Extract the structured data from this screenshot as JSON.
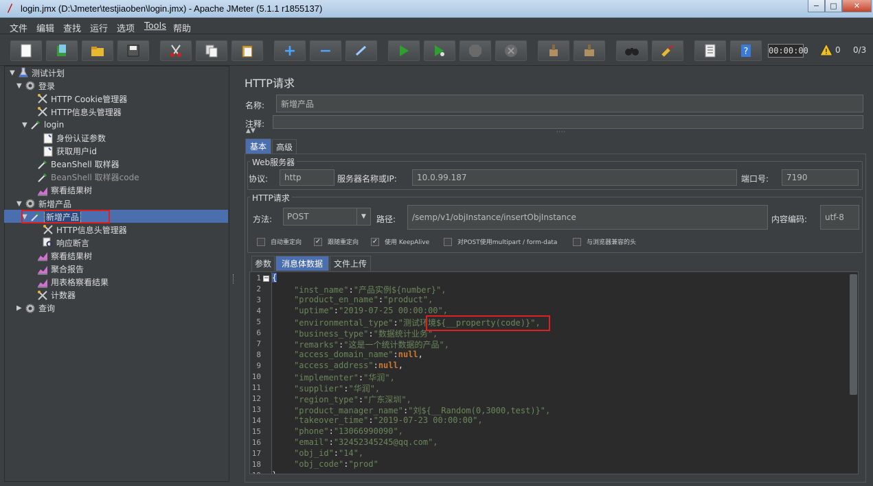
{
  "window": {
    "title": "login.jmx (D:\\Jmeter\\testjiaoben\\login.jmx) - Apache JMeter (5.1.1 r1855137)",
    "min": "−",
    "max": "□",
    "close": "✕"
  },
  "menu": [
    "文件",
    "编辑",
    "查找",
    "运行",
    "选项",
    "Tools",
    "帮助"
  ],
  "toolbar": {
    "buttons": [
      "new",
      "templates",
      "open",
      "save",
      "cut",
      "copy",
      "paste",
      "expand",
      "collapse",
      "toggle",
      "start",
      "start-no-timers",
      "stop",
      "shutdown",
      "clear",
      "clear-all",
      "search",
      "reset-search",
      "function-helper",
      "help"
    ],
    "timer": "00:00:00",
    "warn_count": "0",
    "thread_count": "0/3"
  },
  "tree": {
    "nodes": [
      {
        "label": "测试计划",
        "icon": "flask-icon",
        "arrow": "▼"
      },
      {
        "label": "登录",
        "icon": "gear-icon",
        "arrow": "▼"
      },
      {
        "label": "HTTP Cookie管理器",
        "icon": "wrench-icon",
        "arrow": ""
      },
      {
        "label": "HTTP信息头管理器",
        "icon": "wrench-icon",
        "arrow": ""
      },
      {
        "label": "login",
        "icon": "pipette-icon",
        "arrow": "▼"
      },
      {
        "label": "身份认证参数",
        "icon": "doc-icon",
        "arrow": ""
      },
      {
        "label": "获取用户id",
        "icon": "doc-icon",
        "arrow": ""
      },
      {
        "label": "BeanShell 取样器",
        "icon": "pipette-icon",
        "arrow": ""
      },
      {
        "label": "BeanShell 取样器code",
        "icon": "pipette-icon",
        "arrow": ""
      },
      {
        "label": "察看结果树",
        "icon": "chart-icon",
        "arrow": ""
      },
      {
        "label": "新增产品",
        "icon": "gear-icon",
        "arrow": "▼"
      },
      {
        "label": "新增产品",
        "icon": "pipette-icon",
        "arrow": "▼"
      },
      {
        "label": "HTTP信息头管理器",
        "icon": "wrench-icon",
        "arrow": ""
      },
      {
        "label": "响应断言",
        "icon": "magnifier-icon",
        "arrow": ""
      },
      {
        "label": "察看结果树",
        "icon": "chart-icon",
        "arrow": ""
      },
      {
        "label": "聚合报告",
        "icon": "chart-icon",
        "arrow": ""
      },
      {
        "label": "用表格察看结果",
        "icon": "chart-icon",
        "arrow": ""
      },
      {
        "label": "计数器",
        "icon": "wrench-icon",
        "arrow": ""
      },
      {
        "label": "查询",
        "icon": "gear-icon",
        "arrow": "▶"
      }
    ]
  },
  "panel": {
    "title": "HTTP请求",
    "name_label": "名称:",
    "name_value": "新增产品",
    "comment_label": "注释:",
    "comment_value": "",
    "tabs": [
      "基本",
      "高级"
    ],
    "web_server": {
      "title": "Web服务器",
      "protocol_label": "协议:",
      "protocol_value": "http",
      "server_label": "服务器名称或IP:",
      "server_value": "10.0.99.187",
      "port_label": "端口号:",
      "port_value": "7190"
    },
    "http_request": {
      "title": "HTTP请求",
      "method_label": "方法:",
      "method_value": "POST",
      "path_label": "路径:",
      "path_value": "/semp/v1/objInstance/insertObjInstance",
      "encoding_label": "内容编码:",
      "encoding_value": "utf-8"
    },
    "checkboxes": [
      {
        "label": "自动重定向",
        "checked": false
      },
      {
        "label": "跟随重定向",
        "checked": true
      },
      {
        "label": "使用 KeepAlive",
        "checked": true
      },
      {
        "label": "对POST使用multipart / form-data",
        "checked": false
      },
      {
        "label": "与浏览器兼容的头",
        "checked": false
      }
    ],
    "body_tabs": [
      "参数",
      "消息体数据",
      "文件上传"
    ]
  },
  "editor": {
    "lines": [
      {
        "n": "1",
        "key": "",
        "val": "",
        "raw": "{"
      },
      {
        "n": "2",
        "key": "\"inst_name\"",
        "val": "\"产品实例${number}\","
      },
      {
        "n": "3",
        "key": "\"product_en_name\"",
        "val": "\"product\","
      },
      {
        "n": "4",
        "key": "\"uptime\"",
        "val": "\"2019-07-25 00:00:00\","
      },
      {
        "n": "5",
        "key": "\"environmental_type\"",
        "val": "\"测试环境${__property(code)}\","
      },
      {
        "n": "6",
        "key": "\"business_type\"",
        "val": "\"数据统计业务\","
      },
      {
        "n": "7",
        "key": "\"remarks\"",
        "val": "\"这是一个统计数据的产品\","
      },
      {
        "n": "8",
        "key": "\"access_domain_name\"",
        "kw": "null",
        "val": ","
      },
      {
        "n": "9",
        "key": "\"access_address\"",
        "kw": "null",
        "val": ","
      },
      {
        "n": "10",
        "key": "\"implementer\"",
        "val": "\"华润\","
      },
      {
        "n": "11",
        "key": "\"supplier\"",
        "val": "\"华润\","
      },
      {
        "n": "12",
        "key": "\"region_type\"",
        "val": "\"广东深圳\","
      },
      {
        "n": "13",
        "key": "\"product_manager_name\"",
        "val": "\"刘${__Random(0,3000,test)}\","
      },
      {
        "n": "14",
        "key": "\"takeover_time\"",
        "val": "\"2019-07-23 00:00:00\","
      },
      {
        "n": "15",
        "key": "\"phone\"",
        "val": "\"13066990090\","
      },
      {
        "n": "16",
        "key": "\"email\"",
        "val": "\"32452345245@qq.com\","
      },
      {
        "n": "17",
        "key": "\"obj_id\"",
        "val": "\"14\","
      },
      {
        "n": "18",
        "key": "\"obj_code\"",
        "val": "\"prod\""
      },
      {
        "n": "19",
        "key": "",
        "val": "",
        "raw": "}"
      }
    ]
  }
}
